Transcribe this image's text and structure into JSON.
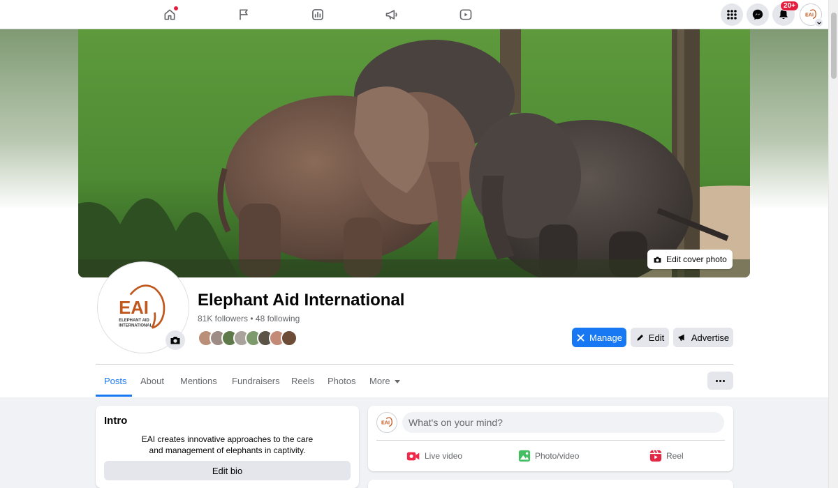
{
  "topbar": {
    "nav_icons": [
      "home-icon",
      "flag-icon",
      "insights-icon",
      "megaphone-icon",
      "video-icon"
    ],
    "notifications_badge": "20+"
  },
  "cover": {
    "edit_cover_label": "Edit cover photo"
  },
  "profile": {
    "logo_text": "EAI",
    "logo_subtext_line1": "ELEPHANT AID",
    "logo_subtext_line2": "INTERNATIONAL",
    "name": "Elephant Aid International",
    "stats": "81K followers • 48 following",
    "follower_count_shown": 8
  },
  "actions": {
    "manage_label": "Manage",
    "edit_label": "Edit",
    "advertise_label": "Advertise"
  },
  "tabs": [
    {
      "label": "Posts",
      "active": true
    },
    {
      "label": "About"
    },
    {
      "label": "Mentions"
    },
    {
      "label": "Fundraisers"
    },
    {
      "label": "Reels"
    },
    {
      "label": "Photos"
    },
    {
      "label": "More"
    }
  ],
  "intro": {
    "title": "Intro",
    "text_line1": "EAI creates innovative approaches to the care",
    "text_line2": "and management of elephants in captivity.",
    "edit_bio_label": "Edit bio"
  },
  "composer": {
    "placeholder": "What's on your mind?",
    "live_video_label": "Live video",
    "photo_video_label": "Photo/video",
    "reel_label": "Reel"
  },
  "colors": {
    "accent": "#1877f2",
    "brand_orange": "#c0581e",
    "live_red": "#f02849",
    "photo_green": "#45bd62",
    "reel_pink": "#e42645"
  }
}
